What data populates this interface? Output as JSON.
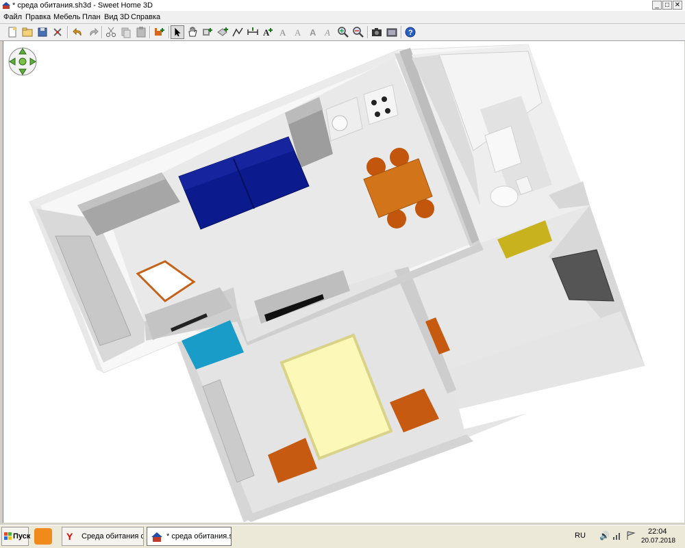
{
  "window": {
    "title": "* среда обитания.sh3d - Sweet Home 3D",
    "controls": {
      "minimize": "_",
      "maximize": "□",
      "close": "✕"
    }
  },
  "menu": {
    "items": [
      "Файл",
      "Правка",
      "Мебель",
      "План",
      "Вид 3D",
      "Справка"
    ]
  },
  "toolbar": {
    "buttons": [
      "new-icon",
      "open-icon",
      "save-icon",
      "cut-preferences-icon",
      "undo-icon",
      "redo-icon",
      "cut-icon",
      "copy-icon",
      "paste-icon",
      "add-furniture-icon",
      "select-icon",
      "pan-icon",
      "create-walls-icon",
      "create-rooms-icon",
      "create-polylines-icon",
      "create-dimensions-icon",
      "add-text-icon",
      "modify-text-icon",
      "bold-icon",
      "italic-icon",
      "zoom-in-icon",
      "zoom-out-icon",
      "create-photo-icon",
      "create-video-icon",
      "help-icon"
    ],
    "selected": "select-icon"
  },
  "view3d": {
    "navigation": "navigation-arrows-icon"
  },
  "taskbar": {
    "start_label": "Пуск",
    "tasks": [
      {
        "label": "Среда обитания ст...",
        "active": false
      },
      {
        "label": "* среда обитания.s...",
        "active": true
      }
    ],
    "lang": "RU",
    "time": "22:04",
    "date": "20.07.2018"
  },
  "colors": {
    "sofa": "#0b1a8c",
    "table": "#d2741a",
    "chairs": "#c2560d",
    "bed": "#fbf8b8",
    "nightstands": "#c55a10",
    "cyan_cabinet": "#1a9cc8",
    "yellow_table": "#c8b21e"
  }
}
